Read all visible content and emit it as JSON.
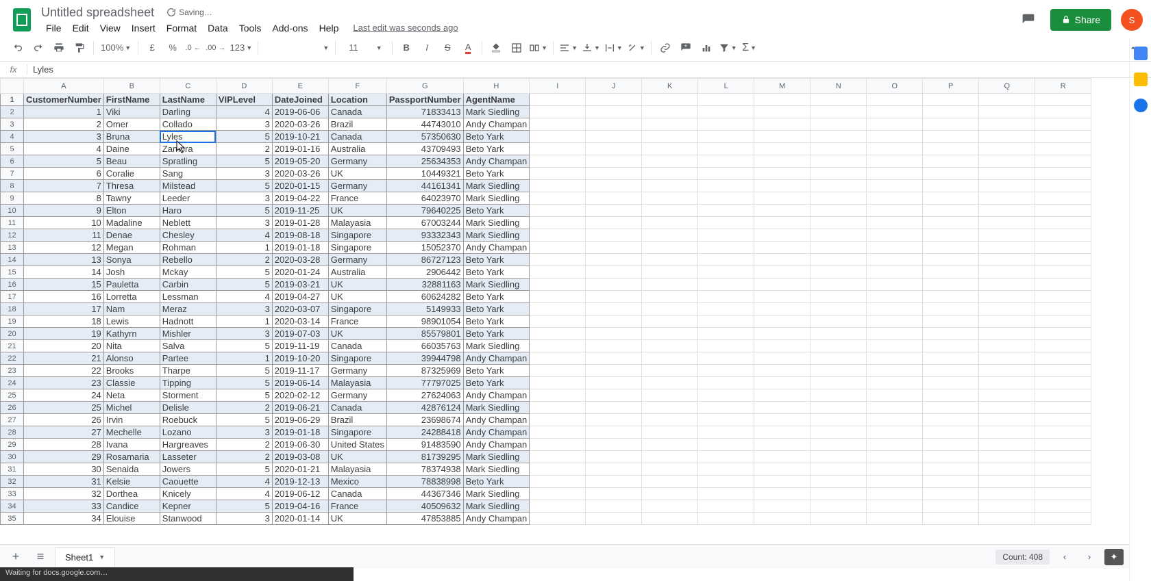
{
  "doc_title": "Untitled spreadsheet",
  "saving_label": "Saving…",
  "menubar": [
    "File",
    "Edit",
    "View",
    "Insert",
    "Format",
    "Data",
    "Tools",
    "Add-ons",
    "Help"
  ],
  "last_edit": "Last edit was seconds ago",
  "share_label": "Share",
  "avatar_letter": "S",
  "toolbar": {
    "zoom": "100%",
    "currency": "£",
    "percent": "%",
    "dec_dec": ".0",
    "dec_inc": ".00",
    "numfmt": "123",
    "font_size": "11"
  },
  "fx_value": "Lyles",
  "columns": [
    "A",
    "B",
    "C",
    "D",
    "E",
    "F",
    "G",
    "H",
    "I",
    "J",
    "K",
    "L",
    "M",
    "N",
    "O",
    "P",
    "Q",
    "R"
  ],
  "headers": [
    "CustomerNumber",
    "FirstName",
    "LastName",
    "VIPLevel",
    "DateJoined",
    "Location",
    "PassportNumber",
    "AgentName"
  ],
  "rows": [
    [
      1,
      "Viki",
      "Darling",
      4,
      "2019-06-06",
      "Canada",
      71833413,
      "Mark Siedling"
    ],
    [
      2,
      "Omer",
      "Collado",
      3,
      "2020-03-26",
      "Brazil",
      44743010,
      "Andy Champan"
    ],
    [
      3,
      "Bruna",
      "Lyles",
      5,
      "2019-10-21",
      "Canada",
      57350630,
      "Beto Yark"
    ],
    [
      4,
      "Daine",
      "Zamora",
      2,
      "2019-01-16",
      "Australia",
      43709493,
      "Beto Yark"
    ],
    [
      5,
      "Beau",
      "Spratling",
      5,
      "2019-05-20",
      "Germany",
      25634353,
      "Andy Champan"
    ],
    [
      6,
      "Coralie",
      "Sang",
      3,
      "2020-03-26",
      "UK",
      10449321,
      "Beto Yark"
    ],
    [
      7,
      "Thresa",
      "Milstead",
      5,
      "2020-01-15",
      "Germany",
      44161341,
      "Mark Siedling"
    ],
    [
      8,
      "Tawny",
      "Leeder",
      3,
      "2019-04-22",
      "France",
      64023970,
      "Mark Siedling"
    ],
    [
      9,
      "Elton",
      "Haro",
      5,
      "2019-11-25",
      "UK",
      79640225,
      "Beto Yark"
    ],
    [
      10,
      "Madaline",
      "Neblett",
      3,
      "2019-01-28",
      "Malayasia",
      67003244,
      "Mark Siedling"
    ],
    [
      11,
      "Denae",
      "Chesley",
      4,
      "2019-08-18",
      "Singapore",
      93332343,
      "Mark Siedling"
    ],
    [
      12,
      "Megan",
      "Rohman",
      1,
      "2019-01-18",
      "Singapore",
      15052370,
      "Andy Champan"
    ],
    [
      13,
      "Sonya",
      "Rebello",
      2,
      "2020-03-28",
      "Germany",
      86727123,
      "Beto Yark"
    ],
    [
      14,
      "Josh",
      "Mckay",
      5,
      "2020-01-24",
      "Australia",
      2906442,
      "Beto Yark"
    ],
    [
      15,
      "Pauletta",
      "Carbin",
      5,
      "2019-03-21",
      "UK",
      32881163,
      "Mark Siedling"
    ],
    [
      16,
      "Lorretta",
      "Lessman",
      4,
      "2019-04-27",
      "UK",
      60624282,
      "Beto Yark"
    ],
    [
      17,
      "Nam",
      "Meraz",
      3,
      "2020-03-07",
      "Singapore",
      5149933,
      "Beto Yark"
    ],
    [
      18,
      "Lewis",
      "Hadnott",
      1,
      "2020-03-14",
      "France",
      98901054,
      "Beto Yark"
    ],
    [
      19,
      "Kathyrn",
      "Mishler",
      3,
      "2019-07-03",
      "UK",
      85579801,
      "Beto Yark"
    ],
    [
      20,
      "Nita",
      "Salva",
      5,
      "2019-11-19",
      "Canada",
      66035763,
      "Mark Siedling"
    ],
    [
      21,
      "Alonso",
      "Partee",
      1,
      "2019-10-20",
      "Singapore",
      39944798,
      "Andy Champan"
    ],
    [
      22,
      "Brooks",
      "Tharpe",
      5,
      "2019-11-17",
      "Germany",
      87325969,
      "Beto Yark"
    ],
    [
      23,
      "Classie",
      "Tipping",
      5,
      "2019-06-14",
      "Malayasia",
      77797025,
      "Beto Yark"
    ],
    [
      24,
      "Neta",
      "Storment",
      5,
      "2020-02-12",
      "Germany",
      27624063,
      "Andy Champan"
    ],
    [
      25,
      "Michel",
      "Delisle",
      2,
      "2019-06-21",
      "Canada",
      42876124,
      "Mark Siedling"
    ],
    [
      26,
      "Irvin",
      "Roebuck",
      5,
      "2019-06-29",
      "Brazil",
      23698674,
      "Andy Champan"
    ],
    [
      27,
      "Mechelle",
      "Lozano",
      3,
      "2019-01-18",
      "Singapore",
      24288418,
      "Andy Champan"
    ],
    [
      28,
      "Ivana",
      "Hargreaves",
      2,
      "2019-06-30",
      "United States",
      91483590,
      "Andy Champan"
    ],
    [
      29,
      "Rosamaria",
      "Lasseter",
      2,
      "2019-03-08",
      "UK",
      81739295,
      "Mark Siedling"
    ],
    [
      30,
      "Senaida",
      "Jowers",
      5,
      "2020-01-21",
      "Malayasia",
      78374938,
      "Mark Siedling"
    ],
    [
      31,
      "Kelsie",
      "Caouette",
      4,
      "2019-12-13",
      "Mexico",
      78838998,
      "Beto Yark"
    ],
    [
      32,
      "Dorthea",
      "Knicely",
      4,
      "2019-06-12",
      "Canada",
      44367346,
      "Mark Siedling"
    ],
    [
      33,
      "Candice",
      "Kepner",
      5,
      "2019-04-16",
      "France",
      40509632,
      "Mark Siedling"
    ],
    [
      34,
      "Elouise",
      "Stanwood",
      3,
      "2020-01-14",
      "UK",
      47853885,
      "Andy Champan"
    ]
  ],
  "active_cell": {
    "row": 3,
    "col": 2
  },
  "sheet_tab": "Sheet1",
  "count_label": "Count: 408",
  "status_text": "Waiting for docs.google.com…"
}
